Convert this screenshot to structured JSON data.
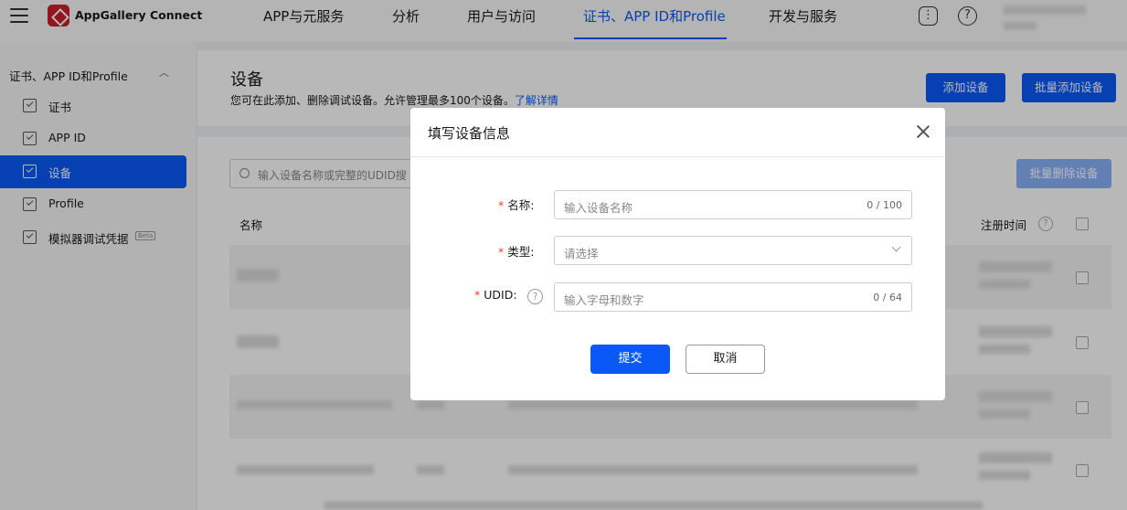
{
  "topbar": {
    "brand": "AppGallery Connect",
    "nav": [
      {
        "label": "APP与元服务",
        "active": false
      },
      {
        "label": "分析",
        "active": false
      },
      {
        "label": "用户与访问",
        "active": false
      },
      {
        "label": "证书、APP ID和Profile",
        "active": true
      },
      {
        "label": "开发与服务",
        "active": false
      }
    ],
    "icons": [
      "feedback-icon",
      "help-icon"
    ],
    "help_glyph": "?"
  },
  "sidebar": {
    "section_title": "证书、APP ID和Profile",
    "items": [
      {
        "label": "证书",
        "active": false
      },
      {
        "label": "APP ID",
        "active": false
      },
      {
        "label": "设备",
        "active": true
      },
      {
        "label": "Profile",
        "active": false
      },
      {
        "label": "模拟器调试凭据",
        "active": false,
        "badge": "Beta"
      }
    ]
  },
  "page": {
    "title": "设备",
    "description": "您可在此添加、删除调试设备。允许管理最多100个设备。",
    "learn_more": "了解详情",
    "add_device_button": "添加设备",
    "batch_add_button": "批量添加设备",
    "search_placeholder": "输入设备名称或完整的UDID搜",
    "batch_delete_button": "批量删除设备",
    "columns": {
      "name": "名称",
      "register_time": "注册时间"
    }
  },
  "modal": {
    "title": "填写设备信息",
    "name_label": "名称:",
    "name_placeholder": "输入设备名称",
    "name_counter": "0 / 100",
    "type_label": "类型:",
    "type_placeholder": "请选择",
    "udid_label": "UDID:",
    "udid_placeholder": "输入字母和数字",
    "udid_counter": "0 / 64",
    "required_mark": "*",
    "submit_button": "提交",
    "cancel_button": "取消"
  },
  "colors": {
    "accent": "#0a59f7",
    "required": "#e84026"
  }
}
